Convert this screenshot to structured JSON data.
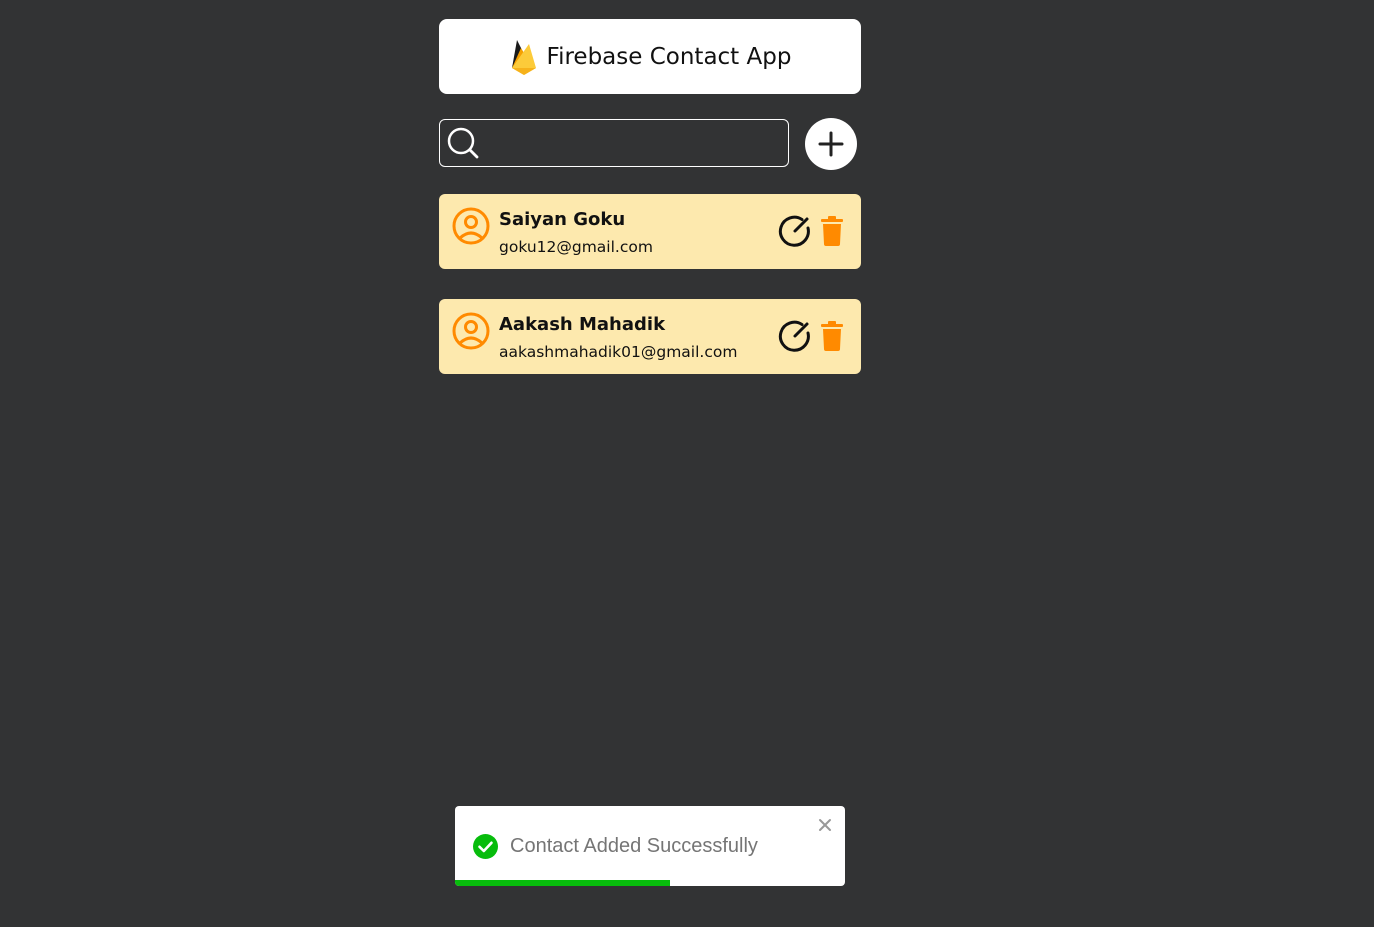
{
  "header": {
    "title": "Firebase Contact App",
    "logo_icon": "firebase-logo"
  },
  "search": {
    "value": "",
    "placeholder": "",
    "icon": "search-icon"
  },
  "add_button": {
    "icon": "plus-icon"
  },
  "contacts": [
    {
      "name": "Saiyan Goku",
      "email": "goku12@gmail.com"
    },
    {
      "name": "Aakash Mahadik",
      "email": "aakashmahadik01@gmail.com"
    }
  ],
  "toast": {
    "message": "Contact Added Successfully",
    "icon": "check-circle-icon",
    "progress": 0.55
  },
  "colors": {
    "background": "#323334",
    "card": "#fde9ae",
    "accent": "#ff8a00",
    "success": "#07bc0c"
  }
}
